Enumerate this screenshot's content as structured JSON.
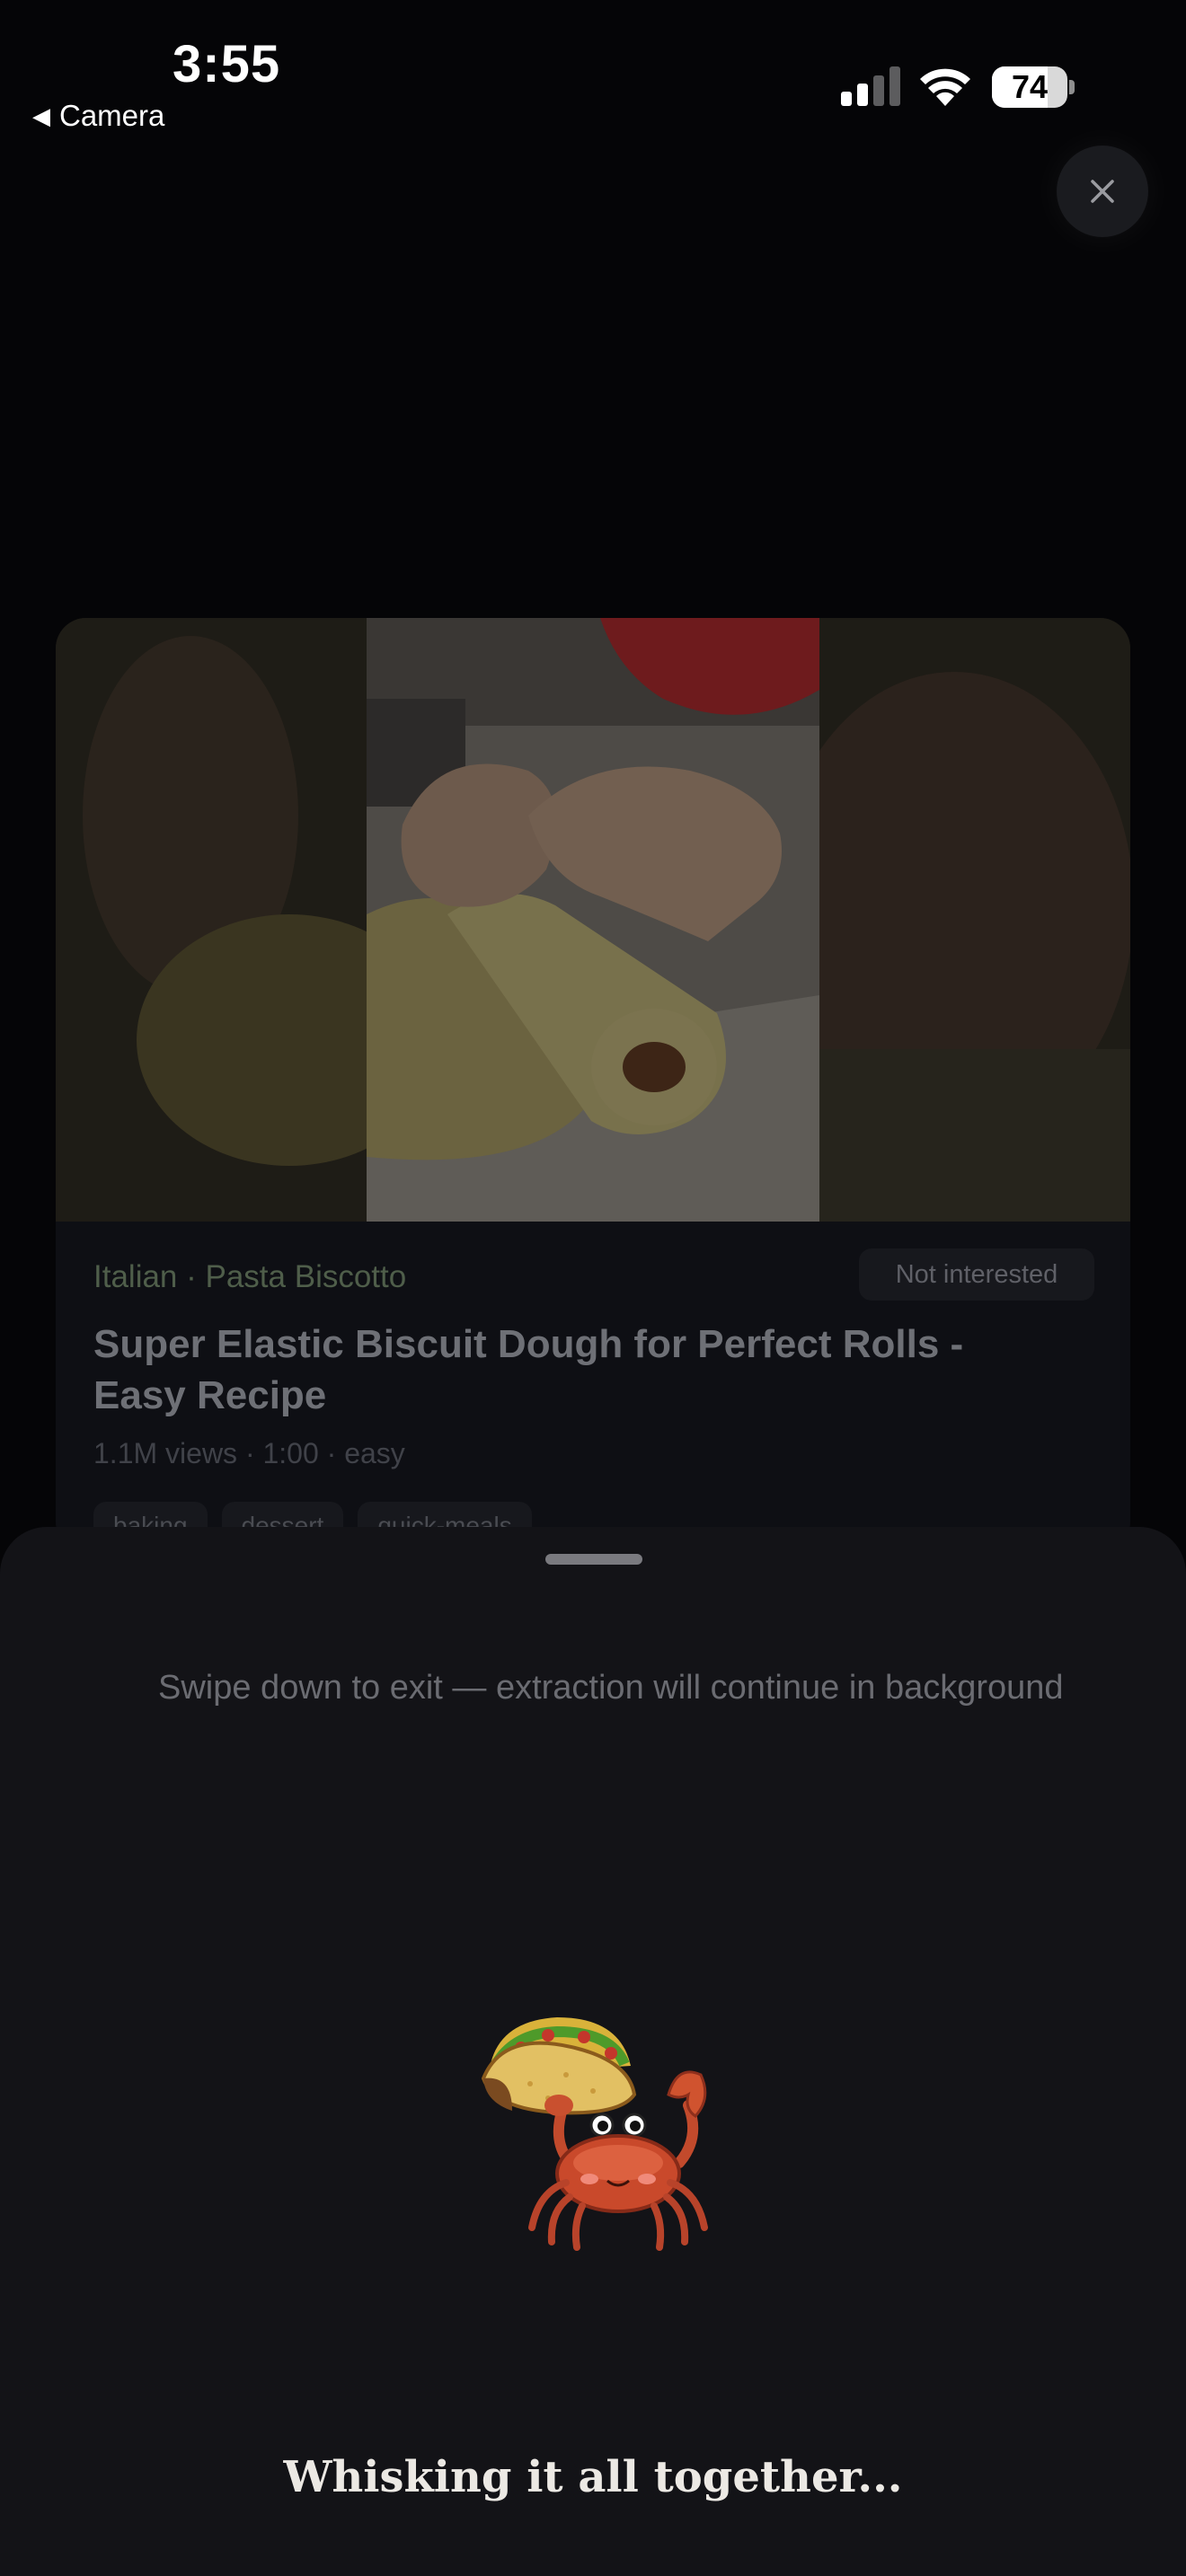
{
  "status_bar": {
    "time": "3:55",
    "back_label": "Camera",
    "battery_percent": "74",
    "battery_level": 0.74
  },
  "close_button": {
    "icon": "close-icon"
  },
  "card": {
    "cuisine": "Italian · Pasta Biscotto",
    "not_interested_label": "Not interested",
    "title": "Super Elastic Biscuit Dough for Perfect Rolls - Easy Recipe",
    "meta": "1.1M views · 1:00 · easy",
    "tags": [
      "baking",
      "dessert",
      "quick-meals"
    ]
  },
  "sheet": {
    "hint": "Swipe down to exit — extraction will continue in background",
    "mascot": "crab-holding-taco-icon",
    "loading_text": "Whisking it all together..."
  },
  "colors": {
    "background": "#050507",
    "sheet": "#131317",
    "cuisine_accent": "#4f5e4a",
    "loading_text": "#ece9e4"
  }
}
